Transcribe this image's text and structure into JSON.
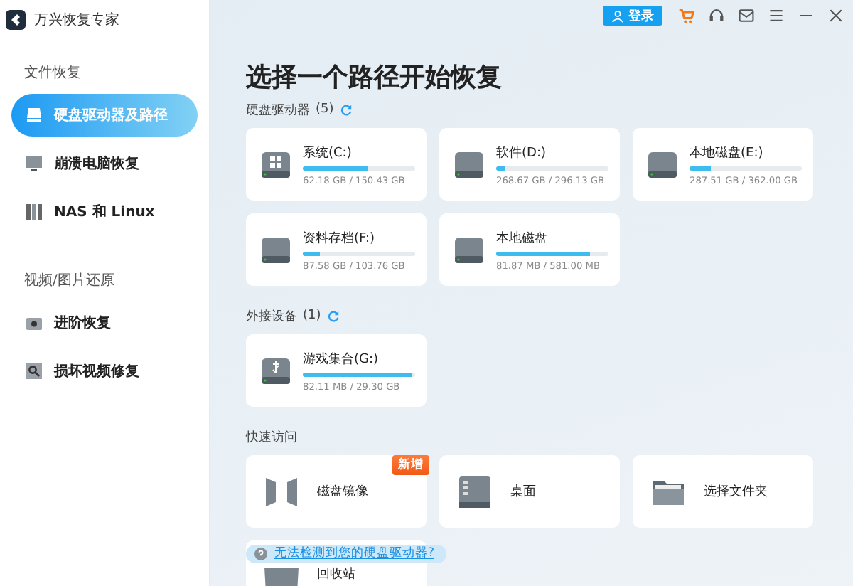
{
  "app": {
    "title": "万兴恢复专家"
  },
  "sidebar": {
    "sections": [
      {
        "label": "文件恢复",
        "items": [
          {
            "label": "硬盘驱动器及路径",
            "kind": "drive",
            "selected": true
          },
          {
            "label": "崩溃电脑恢复",
            "kind": "monitor",
            "selected": false
          },
          {
            "label": "NAS 和 Linux",
            "kind": "nas",
            "selected": false
          }
        ]
      },
      {
        "label": "视频/图片还原",
        "items": [
          {
            "label": "进阶恢复",
            "kind": "camera",
            "selected": false
          },
          {
            "label": "损坏视频修复",
            "kind": "repair",
            "selected": false
          }
        ]
      }
    ]
  },
  "topbar": {
    "login": "登录"
  },
  "title": "选择一个路径开始恢复",
  "drive_sections": [
    {
      "label": "硬盘驱动器",
      "count": "(5)",
      "drives": [
        {
          "name": "系统(C:)",
          "kind": "windows",
          "usage": "62.18 GB / 150.43 GB",
          "level": 0.58
        },
        {
          "name": "软件(D:)",
          "kind": "disk",
          "usage": "268.67 GB / 296.13 GB",
          "level": 0.08
        },
        {
          "name": "本地磁盘(E:)",
          "kind": "disk",
          "usage": "287.51 GB / 362.00 GB",
          "level": 0.19
        },
        {
          "name": "资料存档(F:)",
          "kind": "disk",
          "usage": "87.58 GB / 103.76 GB",
          "level": 0.15
        },
        {
          "name": "本地磁盘",
          "kind": "disk",
          "usage": "81.87 MB / 581.00 MB",
          "level": 0.84
        }
      ]
    },
    {
      "label": "外接设备",
      "count": "(1)",
      "drives": [
        {
          "name": "游戏集合(G:)",
          "kind": "usb",
          "usage": "82.11 MB / 29.30 GB",
          "level": 0.97
        }
      ]
    }
  ],
  "quick_access": {
    "label": "快速访问",
    "items": [
      {
        "label": "磁盘镜像",
        "kind": "image",
        "badge": "新增"
      },
      {
        "label": "桌面",
        "kind": "desktop"
      },
      {
        "label": "选择文件夹",
        "kind": "folder"
      },
      {
        "label": "回收站",
        "kind": "trash"
      }
    ]
  },
  "help_link": "无法检测到您的硬盘驱动器?"
}
